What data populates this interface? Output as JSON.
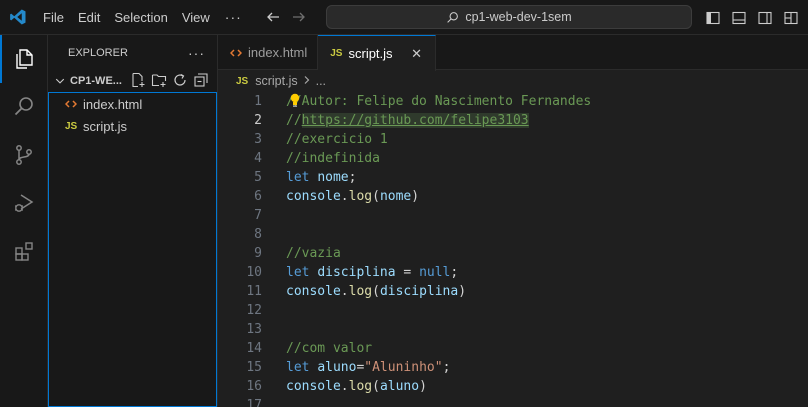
{
  "menu": [
    "File",
    "Edit",
    "Selection",
    "View",
    "···"
  ],
  "search": {
    "text": "cp1-web-dev-1sem"
  },
  "sidebar": {
    "title": "EXPLORER",
    "more": "···",
    "folder": "CP1-WE...",
    "files": [
      {
        "name": "index.html",
        "icon": "html-file-icon"
      },
      {
        "name": "script.js",
        "icon": "js-file-icon"
      }
    ]
  },
  "tabs": [
    {
      "label": "index.html",
      "icon": "html-file-icon",
      "active": false
    },
    {
      "label": "script.js",
      "icon": "js-file-icon",
      "active": true,
      "close": "✕"
    }
  ],
  "breadcrumb": {
    "file": "script.js",
    "rest": "..."
  },
  "editor": {
    "current_line": 2,
    "lines": [
      {
        "n": "1",
        "tokens": [
          {
            "t": "//Autor: Felipe do Nascimento Fernandes",
            "c": "comment"
          }
        ]
      },
      {
        "n": "2",
        "tokens": [
          {
            "t": "//",
            "c": "comment"
          },
          {
            "t": "https://github.com/felipe3103",
            "c": "link"
          }
        ]
      },
      {
        "n": "3",
        "tokens": [
          {
            "t": "//exercicio 1",
            "c": "comment"
          }
        ]
      },
      {
        "n": "4",
        "tokens": [
          {
            "t": "//indefinida",
            "c": "comment"
          }
        ]
      },
      {
        "n": "5",
        "tokens": [
          {
            "t": "let ",
            "c": "kw"
          },
          {
            "t": "nome",
            "c": "var"
          },
          {
            "t": ";",
            "c": "op"
          }
        ]
      },
      {
        "n": "6",
        "tokens": [
          {
            "t": "console",
            "c": "var"
          },
          {
            "t": ".",
            "c": "op"
          },
          {
            "t": "log",
            "c": "fn"
          },
          {
            "t": "(",
            "c": "op"
          },
          {
            "t": "nome",
            "c": "var"
          },
          {
            "t": ")",
            "c": "op"
          }
        ]
      },
      {
        "n": "7",
        "tokens": []
      },
      {
        "n": "8",
        "tokens": []
      },
      {
        "n": "9",
        "tokens": [
          {
            "t": "//vazia",
            "c": "comment"
          }
        ]
      },
      {
        "n": "10",
        "tokens": [
          {
            "t": "let ",
            "c": "kw"
          },
          {
            "t": "disciplina",
            "c": "var"
          },
          {
            "t": " = ",
            "c": "op"
          },
          {
            "t": "null",
            "c": "kw"
          },
          {
            "t": ";",
            "c": "op"
          }
        ]
      },
      {
        "n": "11",
        "tokens": [
          {
            "t": "console",
            "c": "var"
          },
          {
            "t": ".",
            "c": "op"
          },
          {
            "t": "log",
            "c": "fn"
          },
          {
            "t": "(",
            "c": "op"
          },
          {
            "t": "disciplina",
            "c": "var"
          },
          {
            "t": ")",
            "c": "op"
          }
        ]
      },
      {
        "n": "12",
        "tokens": []
      },
      {
        "n": "13",
        "tokens": []
      },
      {
        "n": "14",
        "tokens": [
          {
            "t": "//com valor",
            "c": "comment"
          }
        ]
      },
      {
        "n": "15",
        "tokens": [
          {
            "t": "let ",
            "c": "kw"
          },
          {
            "t": "aluno",
            "c": "var"
          },
          {
            "t": "=",
            "c": "op"
          },
          {
            "t": "\"Aluninho\"",
            "c": "str"
          },
          {
            "t": ";",
            "c": "op"
          }
        ]
      },
      {
        "n": "16",
        "tokens": [
          {
            "t": "console",
            "c": "var"
          },
          {
            "t": ".",
            "c": "op"
          },
          {
            "t": "log",
            "c": "fn"
          },
          {
            "t": "(",
            "c": "op"
          },
          {
            "t": "aluno",
            "c": "var"
          },
          {
            "t": ")",
            "c": "op"
          }
        ]
      },
      {
        "n": "17",
        "tokens": []
      }
    ]
  },
  "colors": {
    "accent": "#0078d4",
    "js_icon": "#cbcb41",
    "html_icon": "#e37933",
    "vscode_logo": "#2489ca"
  }
}
